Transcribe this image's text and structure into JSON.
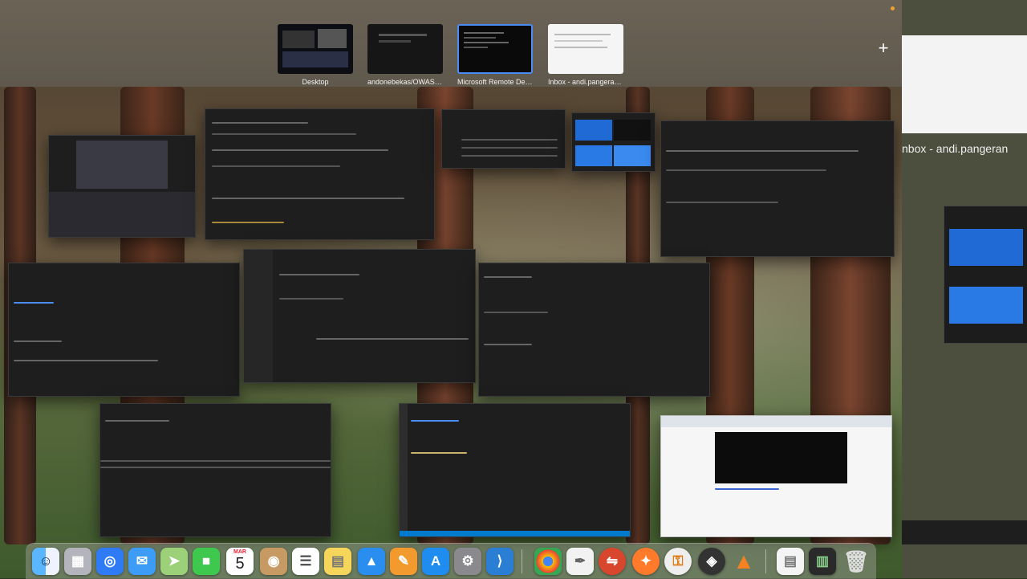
{
  "spaces": [
    {
      "label": "Desktop",
      "active": false
    },
    {
      "label": "andonebekas/OWASP-...",
      "active": false
    },
    {
      "label": "Microsoft Remote Des...",
      "active": true
    },
    {
      "label": "Inbox - andi.pangeran...",
      "active": false
    }
  ],
  "add_space_label": "+",
  "side_window": {
    "title": "nbox - andi.pangeran"
  },
  "dock": {
    "calendar_month": "MAR",
    "calendar_day": "5",
    "apps": [
      "finder",
      "launchpad",
      "safari",
      "mail",
      "maps",
      "facetime",
      "calendar",
      "contacts",
      "reminders",
      "notes",
      "keynote",
      "pages",
      "app-store",
      "system-settings",
      "vscode",
      "chrome",
      "textedit",
      "remote-desktop",
      "firefox",
      "keychain",
      "davinci",
      "vlc",
      "preview-doc",
      "activity",
      "trash"
    ]
  },
  "colors": {
    "accent": "#4a8df7"
  }
}
